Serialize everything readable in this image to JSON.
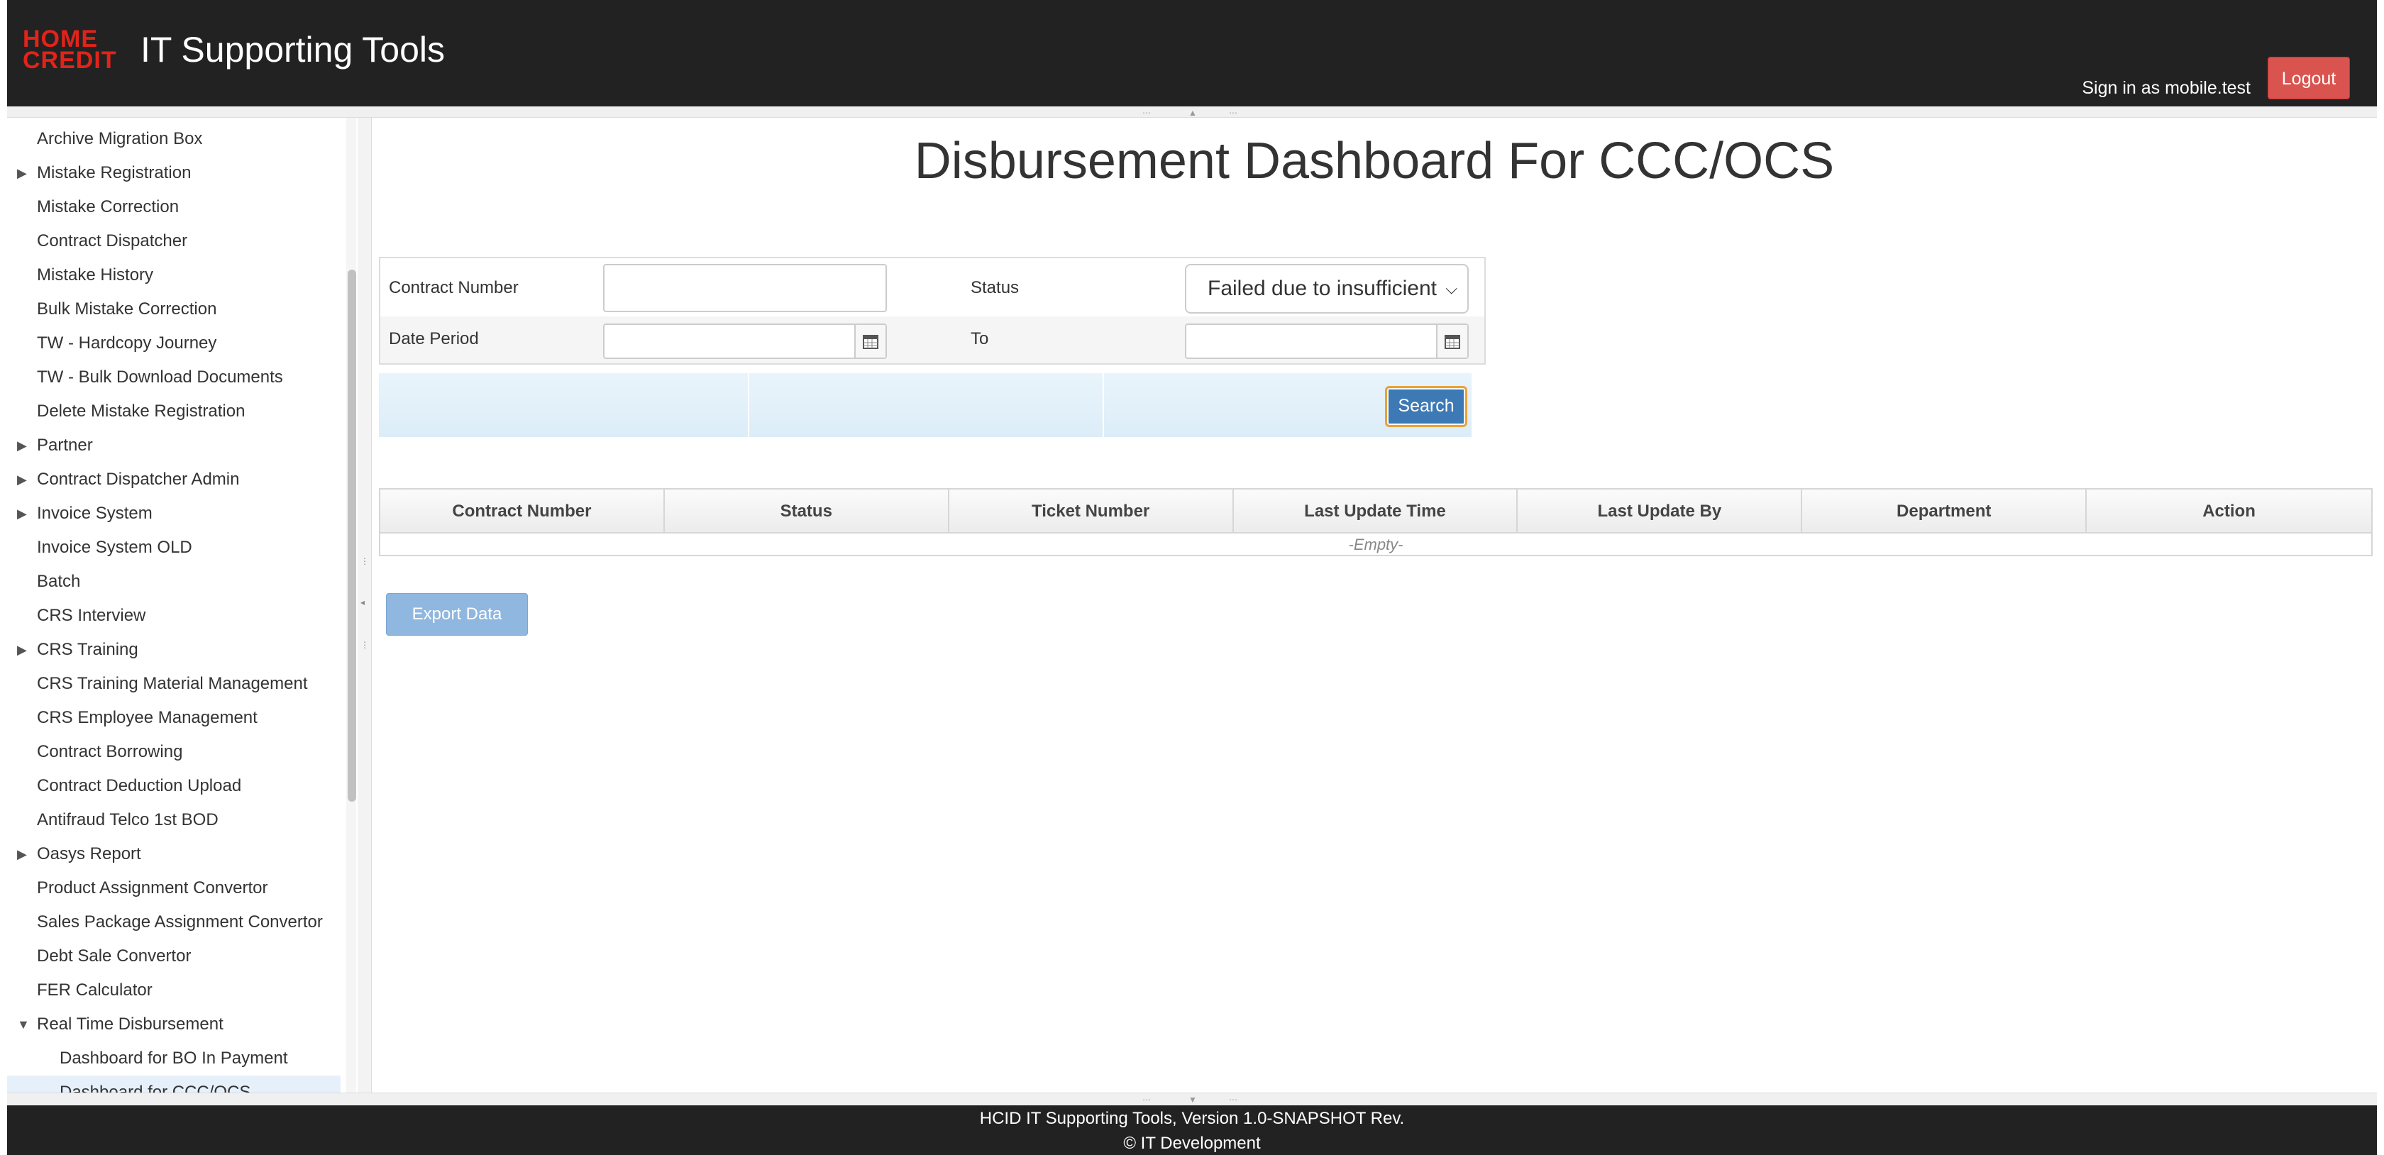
{
  "header": {
    "logo_line1": "HOME",
    "logo_line2": "CREDIT",
    "app_title": "IT Supporting Tools",
    "sign_in_text": "Sign in as mobile.test",
    "logout_label": "Logout"
  },
  "sidebar": {
    "items": [
      {
        "label": "Archive Migration Box",
        "expandable": false
      },
      {
        "label": "Mistake Registration",
        "expandable": true
      },
      {
        "label": "Mistake Correction",
        "expandable": false
      },
      {
        "label": "Contract Dispatcher",
        "expandable": false
      },
      {
        "label": "Mistake History",
        "expandable": false
      },
      {
        "label": "Bulk Mistake Correction",
        "expandable": false
      },
      {
        "label": "TW - Hardcopy Journey",
        "expandable": false
      },
      {
        "label": "TW - Bulk Download Documents",
        "expandable": false
      },
      {
        "label": "Delete Mistake Registration",
        "expandable": false
      },
      {
        "label": "Partner",
        "expandable": true
      },
      {
        "label": "Contract Dispatcher Admin",
        "expandable": true
      },
      {
        "label": "Invoice System",
        "expandable": true
      },
      {
        "label": "Invoice System OLD",
        "expandable": false
      },
      {
        "label": "Batch",
        "expandable": false
      },
      {
        "label": "CRS Interview",
        "expandable": false
      },
      {
        "label": "CRS Training",
        "expandable": true
      },
      {
        "label": "CRS Training Material Management",
        "expandable": false
      },
      {
        "label": "CRS Employee Management",
        "expandable": false
      },
      {
        "label": "Contract Borrowing",
        "expandable": false
      },
      {
        "label": "Contract Deduction Upload",
        "expandable": false
      },
      {
        "label": "Antifraud Telco 1st BOD",
        "expandable": false
      },
      {
        "label": "Oasys Report",
        "expandable": true
      },
      {
        "label": "Product Assignment Convertor",
        "expandable": false
      },
      {
        "label": "Sales Package Assignment Convertor",
        "expandable": false
      },
      {
        "label": "Debt Sale Convertor",
        "expandable": false
      },
      {
        "label": "FER Calculator",
        "expandable": false
      },
      {
        "label": "Real Time Disbursement",
        "expandable": true,
        "expanded": true
      },
      {
        "label": "Dashboard for BO In Payment",
        "expandable": false,
        "child": true
      },
      {
        "label": "Dashboard for CCC/OCS",
        "expandable": false,
        "child": true,
        "active": true
      }
    ]
  },
  "main": {
    "page_title": "Disbursement Dashboard For CCC/OCS",
    "form": {
      "contract_number_label": "Contract Number",
      "contract_number_value": "",
      "status_label": "Status",
      "status_selected": "Failed due to insufficient",
      "date_period_label": "Date Period",
      "date_from_value": "",
      "to_label": "To",
      "date_to_value": ""
    },
    "search_label": "Search",
    "grid": {
      "columns": [
        "Contract Number",
        "Status",
        "Ticket Number",
        "Last Update Time",
        "Last Update By",
        "Department",
        "Action"
      ],
      "rows": [],
      "empty_text": "-Empty-"
    },
    "export_label": "Export Data"
  },
  "footer": {
    "line1": "HCID IT Supporting Tools, Version 1.0-SNAPSHOT Rev.",
    "line2": "© IT Development"
  },
  "colors": {
    "header_bg": "#222222",
    "brand_red": "#e2231a",
    "logout_bg": "#d9534f",
    "search_bg": "#3c79b5",
    "export_bg": "#8fb7df",
    "active_nav_bg": "#e5f0fb"
  }
}
